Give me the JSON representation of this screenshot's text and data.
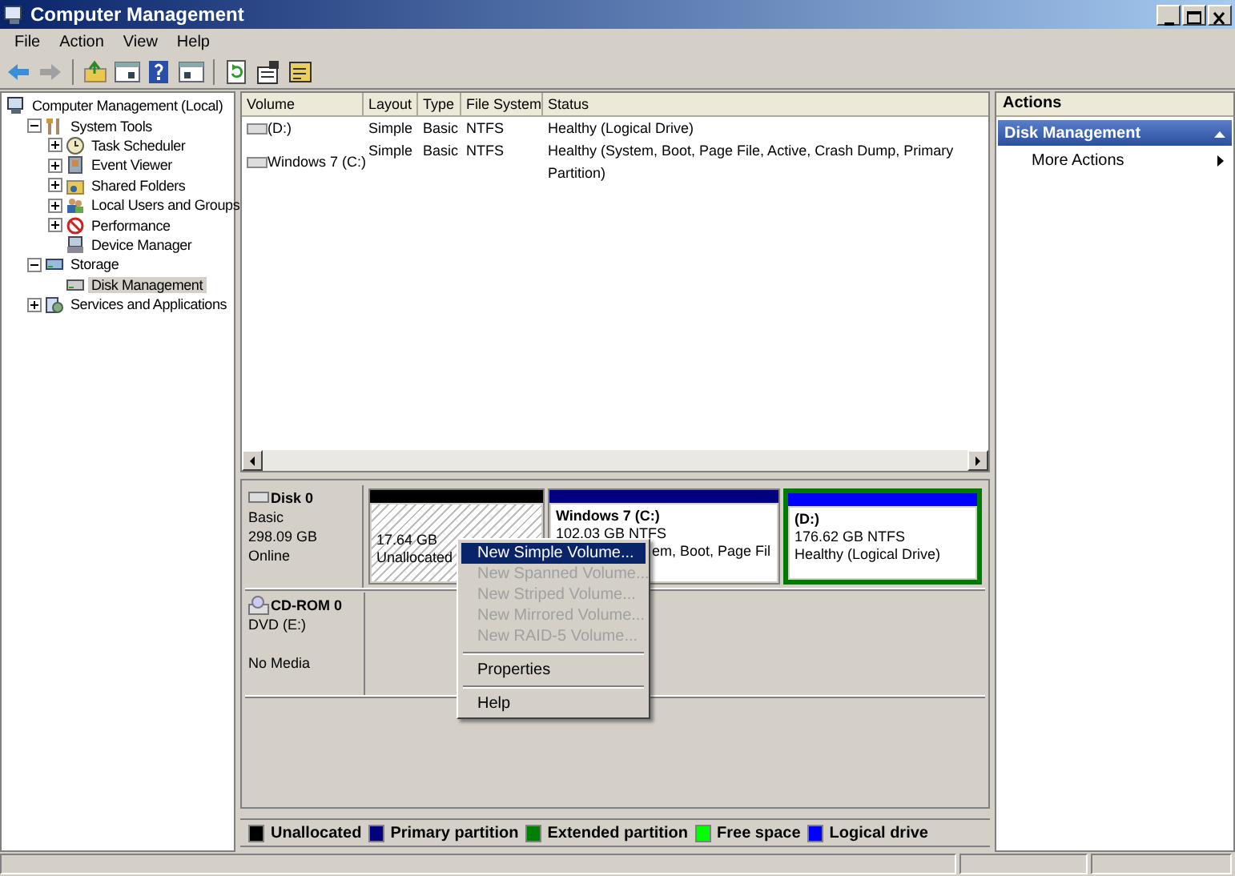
{
  "window": {
    "title": "Computer Management"
  },
  "menu_bar": [
    "File",
    "Action",
    "View",
    "Help"
  ],
  "tree": [
    {
      "label": "Computer Management (Local)",
      "selected": false,
      "children": [
        {
          "label": "System Tools",
          "expanded": true,
          "selected": false,
          "children": [
            {
              "label": "Task Scheduler",
              "expanded": false,
              "selected": false
            },
            {
              "label": "Event Viewer",
              "expanded": false,
              "selected": false
            },
            {
              "label": "Shared Folders",
              "expanded": false,
              "selected": false
            },
            {
              "label": "Local Users and Groups",
              "expanded": false,
              "selected": false
            },
            {
              "label": "Performance",
              "expanded": false,
              "selected": false
            },
            {
              "label": "Device Manager",
              "selected": false
            }
          ]
        },
        {
          "label": "Storage",
          "expanded": true,
          "selected": false,
          "children": [
            {
              "label": "Disk Management",
              "selected": true
            }
          ]
        },
        {
          "label": "Services and Applications",
          "expanded": false,
          "selected": false
        }
      ]
    }
  ],
  "volumes": {
    "columns": [
      "Volume",
      "Layout",
      "Type",
      "File System",
      "Status"
    ],
    "rows": [
      [
        "(D:)",
        "Simple",
        "Basic",
        "NTFS",
        "Healthy (Logical Drive)"
      ],
      [
        "Windows 7 (C:)",
        "Simple",
        "Basic",
        "NTFS",
        "Healthy (System, Boot, Page File, Active, Crash Dump, Primary Partition)"
      ]
    ]
  },
  "disks": [
    {
      "kind": "disk",
      "name": "Disk 0",
      "lines": [
        "Basic",
        "298.09 GB",
        "Online"
      ],
      "partitions": [
        {
          "kind": "unallocated",
          "lines": [
            "17.64 GB",
            "Unallocated"
          ]
        },
        {
          "kind": "primary",
          "name": "Windows 7  (C:)",
          "lines": [
            "102.03 GB NTFS",
            "em, Boot, Page Fil"
          ]
        },
        {
          "kind": "logical",
          "name": "(D:)",
          "lines": [
            "176.62 GB NTFS",
            "Healthy (Logical Drive)"
          ]
        }
      ]
    },
    {
      "kind": "cdrom",
      "name": "CD-ROM 0",
      "lines": [
        "DVD (E:)",
        "No Media"
      ]
    }
  ],
  "context_menu": [
    {
      "kind": "item",
      "label": "New Simple Volume...",
      "disabled": false,
      "selected": true
    },
    {
      "kind": "item",
      "label": "New Spanned Volume...",
      "disabled": true,
      "selected": false
    },
    {
      "kind": "item",
      "label": "New Striped Volume...",
      "disabled": true,
      "selected": false
    },
    {
      "kind": "item",
      "label": "New Mirrored Volume...",
      "disabled": true,
      "selected": false
    },
    {
      "kind": "item",
      "label": "New RAID-5 Volume...",
      "disabled": true,
      "selected": false
    },
    {
      "kind": "separator"
    },
    {
      "kind": "item",
      "label": "Properties",
      "disabled": false,
      "selected": false
    },
    {
      "kind": "separator"
    },
    {
      "kind": "item",
      "label": "Help",
      "disabled": false,
      "selected": false
    }
  ],
  "legend": [
    {
      "label": "Unallocated",
      "color": "#000000"
    },
    {
      "label": "Primary partition",
      "color": "#000080"
    },
    {
      "label": "Extended partition",
      "color": "#008000"
    },
    {
      "label": "Free space",
      "color": "#00ff00"
    },
    {
      "label": "Logical drive",
      "color": "#0000ff"
    }
  ],
  "actions": {
    "title": "Actions",
    "sections": [
      {
        "title": "Disk Management",
        "expanded": true,
        "items": [
          "More Actions"
        ]
      }
    ]
  }
}
